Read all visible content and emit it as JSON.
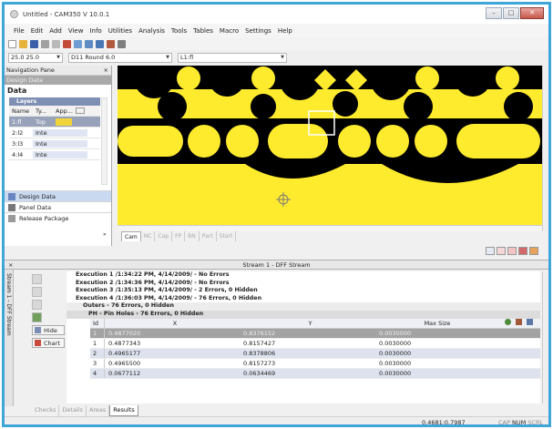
{
  "window": {
    "title": "Untitled - CAM350 V 10.0.1",
    "controls": [
      "–",
      "□",
      "✕"
    ]
  },
  "menu": [
    "File",
    "Edit",
    "Add",
    "View",
    "Info",
    "Utilities",
    "Analysis",
    "Tools",
    "Tables",
    "Macro",
    "Settings",
    "Help"
  ],
  "toolbar": {
    "grid_value": "25.0 25.0",
    "dcode_value": "D11  Round 6.0",
    "layer_value": "L1:fl"
  },
  "nav": {
    "pane_title": "Navigation Pane",
    "close": "×",
    "section": "Design Data",
    "data_heading": "Data",
    "layers_label": "Layers",
    "columns": [
      "Name",
      "Ty...",
      "App..."
    ],
    "rows": [
      {
        "name": "1:fl",
        "type": "Top"
      },
      {
        "name": "2:l2",
        "type": "Inte"
      },
      {
        "name": "3:l3",
        "type": "Inte"
      },
      {
        "name": "4:l4",
        "type": "Inte"
      }
    ],
    "buttons": [
      "Design Data",
      "Panel Data",
      "Release Package"
    ],
    "more": "»"
  },
  "canvas": {
    "colors": {
      "background": "#000000",
      "copper": "#ffeb2e",
      "selection": "#ffffff",
      "cursor": "#7a7a7a"
    },
    "tabs": [
      "Cam",
      "NC",
      "Cap",
      "FP",
      "BN",
      "Part",
      "Start"
    ]
  },
  "stream": {
    "title": "Stream 1 - DFF Stream",
    "side_label": "Stream 1 - DFF Stream",
    "close": "×",
    "hide_label": "Hide",
    "chart_label": "Chart",
    "executions": [
      "Execution 1 /1:34:22 PM, 4/14/2009/ - No Errors",
      "Execution 2 /1:34:36 PM, 4/14/2009/ - No Errors",
      "Execution 3 /1:35:13 PM, 4/14/2009/ - 2 Errors, 0 Hidden",
      "Execution 4 /1:36:03 PM, 4/14/2009/ - 76 Errors, 0 Hidden"
    ],
    "outers": "Outers - 76 Errors, 0 Hidden",
    "pin_holes": "PH - Pin Holes - 76 Errors, 0 Hidden",
    "columns": {
      "id": "Id",
      "x": "X",
      "y": "Y",
      "max": "Max Size"
    },
    "rows": [
      {
        "id": "1",
        "x": "0.4877020",
        "y": "0.8376152",
        "max": "0.0030000"
      },
      {
        "id": "1",
        "x": "0.4877343",
        "y": "0.8157427",
        "max": "0.0030000"
      },
      {
        "id": "2",
        "x": "0.4965177",
        "y": "0.8378806",
        "max": "0.0030000"
      },
      {
        "id": "3",
        "x": "0.4965500",
        "y": "0.8157273",
        "max": "0.0030000"
      },
      {
        "id": "4",
        "x": "0.0677112",
        "y": "0.0634469",
        "max": "0.0030000"
      }
    ],
    "tabs": [
      "Checks",
      "Details",
      "Areas",
      "Results"
    ]
  },
  "status": {
    "coords": "0.4681:0.7987",
    "cap": "CAP",
    "num": "NUM",
    "scrl": "SCRL"
  }
}
